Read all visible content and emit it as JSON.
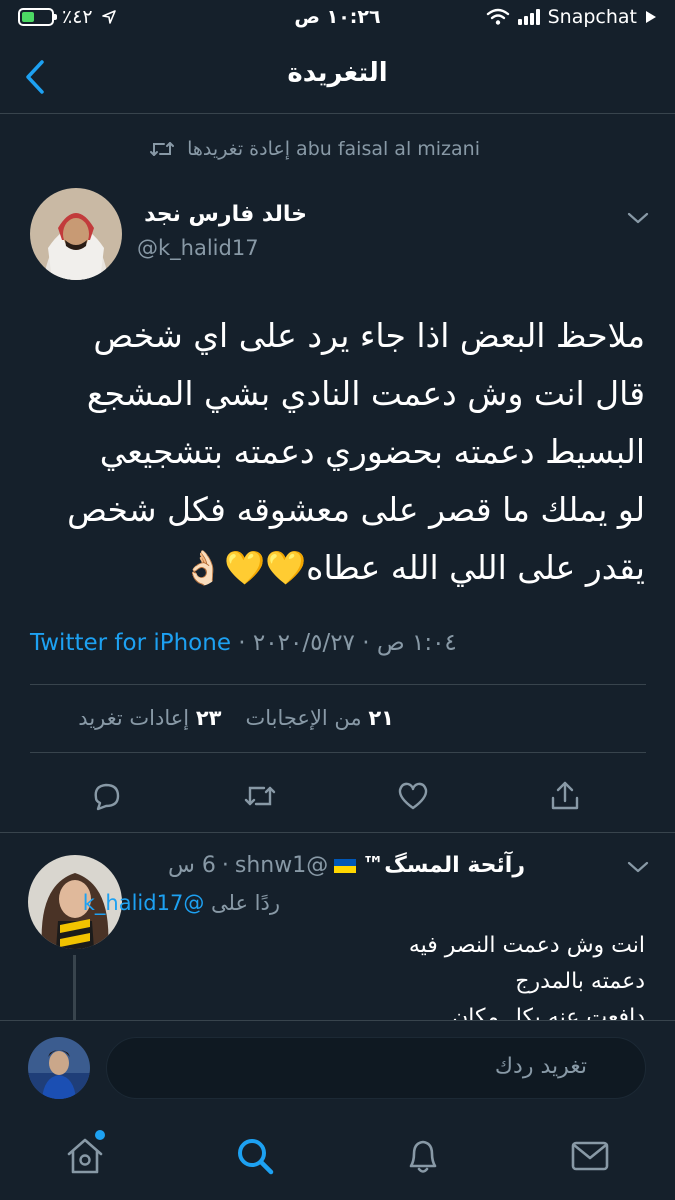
{
  "status_bar": {
    "battery_percent_text": "٪٤٢",
    "battery_level": 0.42,
    "time": "١٠:٢٦ ص",
    "carrier": "Snapchat"
  },
  "header": {
    "title": "التغريدة",
    "back_icon": "chevron-left-icon"
  },
  "retweet": {
    "text": "abu faisal al mizani إعادة تغريدها",
    "icon": "retweet-icon"
  },
  "tweet": {
    "author_name": "خالد فارس نجد",
    "author_handle": "@k_halid17",
    "lines": [
      "ملاحظ البعض اذا جاء يرد على اي شخص",
      "قال انت وش دعمت النادي بشي المشجع",
      "البسيط دعمته بحضوري دعمته بتشجيعي",
      "لو يملك ما قصر على معشوقه فكل شخص",
      "يقدر على اللي الله عطاه💛💛👌🏻"
    ],
    "time": "١:٠٤ ص",
    "date": "٢٠٢٠/٥/٢٧",
    "separator": "·",
    "source": "Twitter for iPhone",
    "likes_count": "٢١",
    "likes_label": "من الإعجابات",
    "retweets_count": "٢٣",
    "retweets_label": "إعادات تغريد"
  },
  "actions": {
    "reply": "comment-icon",
    "retweet": "retweet-icon",
    "like": "heart-icon",
    "share": "share-icon"
  },
  "reply": {
    "name": "رآئحة المسگ™",
    "handle": "@shnw1",
    "age": "6 س",
    "replying_label": "ردًا على",
    "replying_to": "@k_halid17",
    "lines": [
      "انت وش دعمت النصر فيه",
      "دعمته بالمدرج",
      "دافعت عنه بكل مكان"
    ]
  },
  "compose": {
    "placeholder": "تغريد ردك"
  },
  "tabs": [
    "home-icon",
    "search-icon",
    "bell-icon",
    "mail-icon"
  ],
  "colors": {
    "background": "#15202b",
    "accent": "#1da1f2",
    "muted": "#8899a6",
    "divider": "#38444d"
  }
}
